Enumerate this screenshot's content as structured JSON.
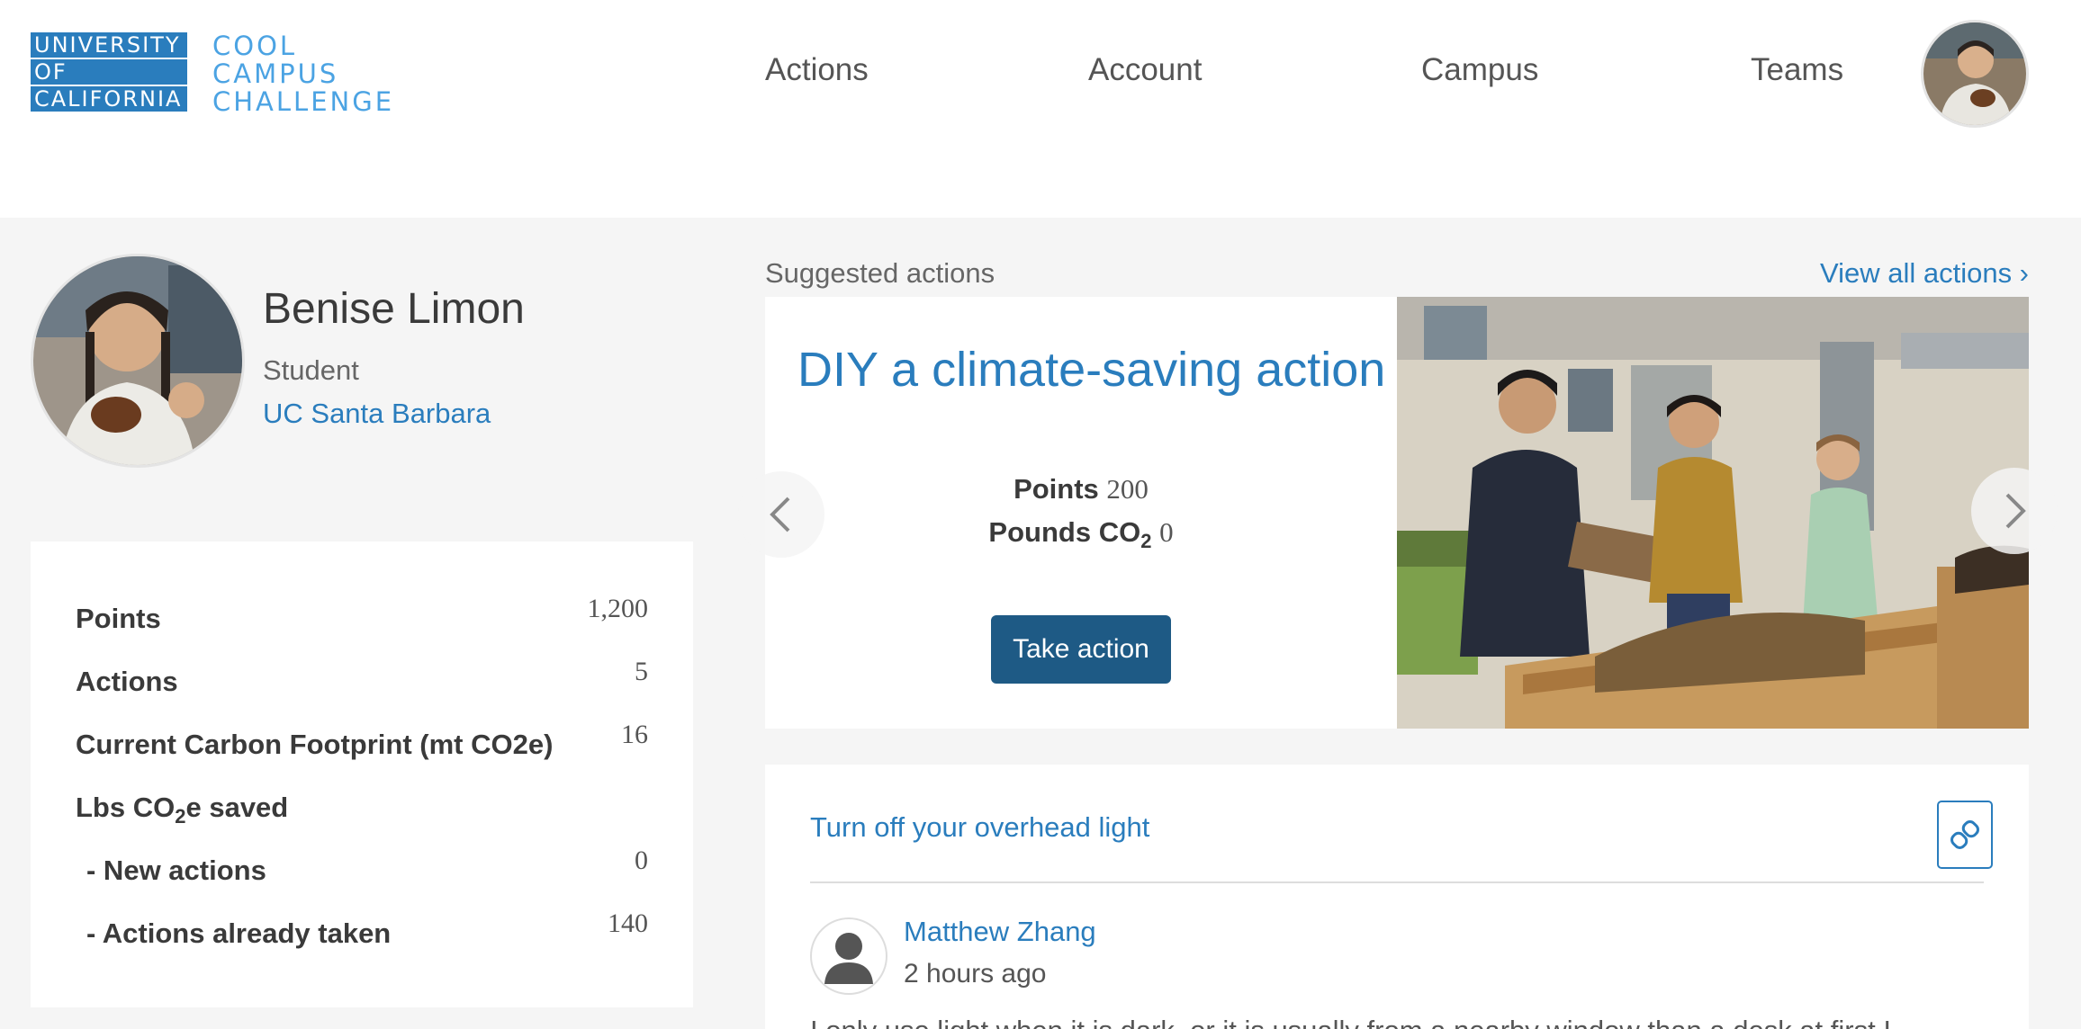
{
  "header": {
    "logo": {
      "uc_lines": [
        "UNIVERSITY",
        "OF",
        "CALIFORNIA"
      ],
      "ccc_lines": [
        "COOL",
        "CAMPUS",
        "CHALLENGE"
      ]
    },
    "nav": [
      {
        "label": "Actions"
      },
      {
        "label": "Account"
      },
      {
        "label": "Campus"
      },
      {
        "label": "Teams"
      }
    ]
  },
  "profile": {
    "name": "Benise Limon",
    "role": "Student",
    "campus": "UC Santa Barbara"
  },
  "stats": {
    "rows": [
      {
        "label": "Points",
        "value": "1,200"
      },
      {
        "label": "Actions",
        "value": "5"
      },
      {
        "label": "Current Carbon Footprint (mt CO2e)",
        "value": "16"
      },
      {
        "label_prefix": "Lbs CO",
        "label_sub": "2",
        "label_suffix": "e saved",
        "value": ""
      },
      {
        "label": "- New actions",
        "value": "0"
      },
      {
        "label": "- Actions already taken",
        "value": "140"
      }
    ]
  },
  "suggested": {
    "title": "Suggested actions",
    "view_all": "View all actions ›",
    "card": {
      "title": "DIY a climate-saving action",
      "points_label": "Points",
      "points_value": "200",
      "co2_label_prefix": "Pounds CO",
      "co2_label_sub": "2",
      "co2_value": "0",
      "button": "Take action"
    }
  },
  "feed": {
    "item_title": "Turn off your overhead light",
    "user": "Matthew Zhang",
    "time": "2 hours ago",
    "body": "I only use light when it is dark, or it is usually from a nearby window than a desk at first I..."
  },
  "colors": {
    "accent": "#2a7dbd",
    "button": "#1e5a85",
    "page_bg": "#f5f5f5"
  }
}
